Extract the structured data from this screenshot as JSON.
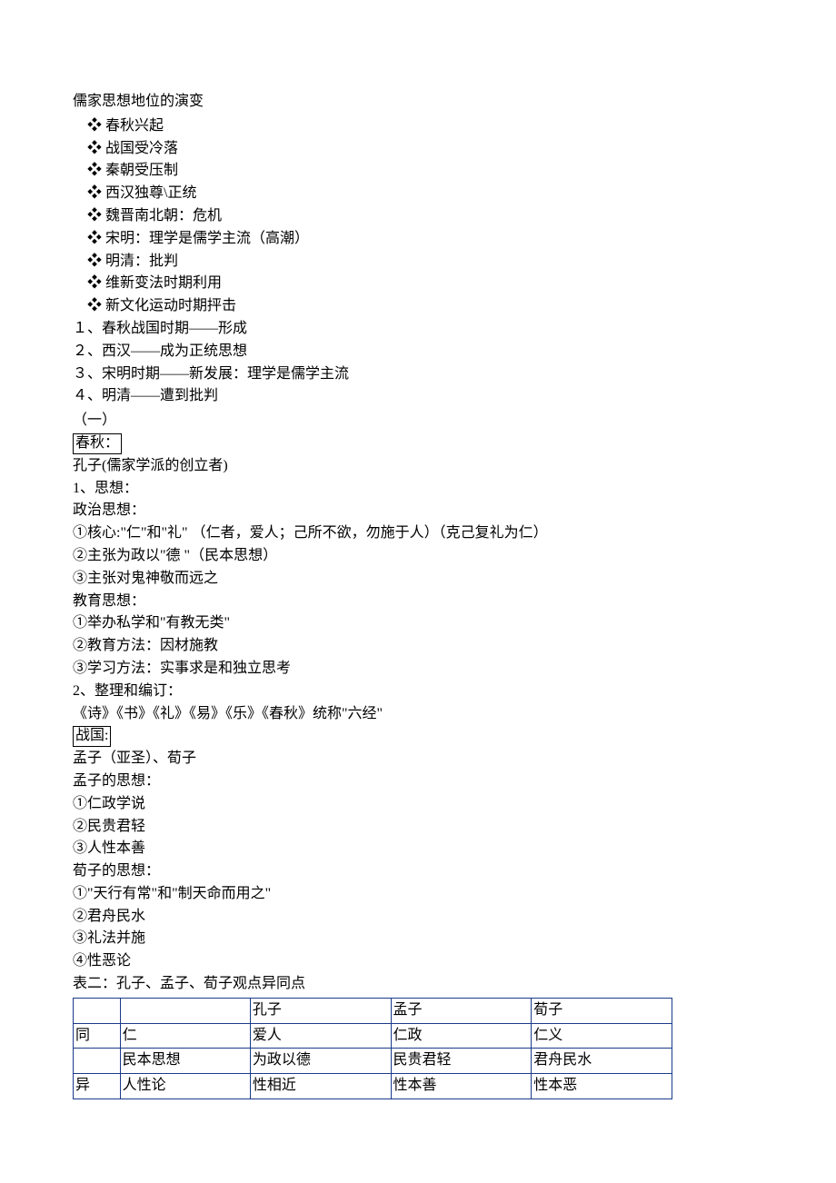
{
  "title": "儒家思想地位的演变",
  "bullets": [
    "春秋兴起",
    "战国受冷落",
    "秦朝受压制",
    "西汉独尊\\正统",
    "魏晋南北朝：危机",
    "宋明：理学是儒学主流（高潮）",
    "明清：批判",
    "维新变法时期利用",
    "新文化运动时期抨击"
  ],
  "numbered": [
    "１、春秋战国时期——形成",
    "２、西汉——成为正统思想",
    "３、宋明时期——新发展：理学是儒学主流",
    "４、明清——遭到批判"
  ],
  "section_marker": "（一）",
  "chunqiu_label": "春秋：",
  "kongzi_intro": "孔子(儒家学派的创立者)",
  "sixiang_header": "1、思想：",
  "zhengzhi_header": "政治思想：",
  "zhengzhi_items": [
    "①核心:\"仁\"和\"礼\"  （仁者，爱人；己所不欲，勿施于人）（克己复礼为仁）",
    "②主张为政以\"德 \"（民本思想）",
    "③主张对鬼神敬而远之"
  ],
  "jiaoyu_header": "教育思想：",
  "jiaoyu_items": [
    "①举办私学和\"有教无类\"",
    "②教育方法：因材施教",
    "③学习方法：实事求是和独立思考"
  ],
  "zhengli_header": "2、整理和编订：",
  "zhengli_content": "《诗》《书》《礼》《易》《乐》《春秋》统称\"六经\"",
  "zhanguo_label": "战国:",
  "mengxun_intro": "孟子（亚圣）、荀子",
  "mengzi_header": "孟子的思想：",
  "mengzi_items": [
    "①仁政学说",
    "②民贵君轻",
    "③人性本善"
  ],
  "xunzi_header": "荀子的思想：",
  "xunzi_items": [
    "①\"天行有常\"和\"制天命而用之\"",
    "②君舟民水",
    "③礼法并施",
    "④性恶论"
  ],
  "table_title": "表二：孔子、孟子、荀子观点异同点",
  "table": {
    "head": [
      "",
      "",
      "孔子",
      "孟子",
      "荀子"
    ],
    "rows": [
      [
        "同",
        "仁",
        "爱人",
        "仁政",
        "仁义"
      ],
      [
        "",
        "民本思想",
        "为政以德",
        "民贵君轻",
        "君舟民水"
      ],
      [
        "异",
        "人性论",
        "性相近",
        "性本善",
        "性本恶"
      ]
    ]
  }
}
